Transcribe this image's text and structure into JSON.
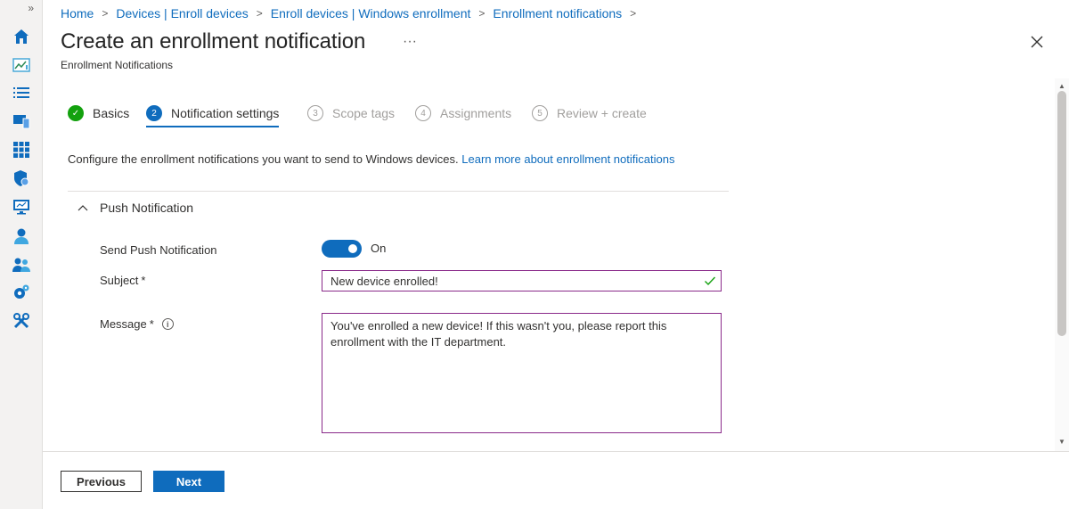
{
  "rail": {
    "expand_label": "»",
    "items": [
      {
        "name": "home-icon"
      },
      {
        "name": "dashboard-icon"
      },
      {
        "name": "all-services-icon"
      },
      {
        "name": "devices-icon"
      },
      {
        "name": "apps-icon"
      },
      {
        "name": "endpoint-security-icon"
      },
      {
        "name": "reports-icon"
      },
      {
        "name": "users-icon"
      },
      {
        "name": "groups-icon"
      },
      {
        "name": "tenant-administration-icon"
      },
      {
        "name": "troubleshooting-icon"
      }
    ]
  },
  "breadcrumb": {
    "items": [
      "Home",
      "Devices | Enroll devices",
      "Enroll devices | Windows enrollment",
      "Enrollment notifications"
    ],
    "separator": ">"
  },
  "header": {
    "title": "Create an enrollment notification",
    "subtitle": "Enrollment Notifications",
    "more_label": "···"
  },
  "steps": [
    {
      "number": "✓",
      "label": "Basics",
      "state": "done"
    },
    {
      "number": "2",
      "label": "Notification settings",
      "state": "active"
    },
    {
      "number": "3",
      "label": "Scope tags",
      "state": "future"
    },
    {
      "number": "4",
      "label": "Assignments",
      "state": "future"
    },
    {
      "number": "5",
      "label": "Review + create",
      "state": "future"
    }
  ],
  "description": {
    "text": "Configure the enrollment notifications you want to send to Windows devices. ",
    "link": "Learn more about enrollment notifications"
  },
  "section": {
    "title": "Push Notification"
  },
  "form": {
    "send_push_label": "Send Push Notification",
    "toggle_state": "On",
    "subject_label": "Subject",
    "subject_required": "*",
    "subject_value": "New device enrolled!",
    "message_label": "Message",
    "message_required": "*",
    "message_info": "i",
    "message_value": "You've enrolled a new device! If this wasn't you, please report this enrollment with the IT department."
  },
  "footer": {
    "previous_label": "Previous",
    "next_label": "Next"
  },
  "colors": {
    "accent": "#0f6cbd",
    "success": "#13a10e",
    "field_border": "#8a2a8a"
  }
}
